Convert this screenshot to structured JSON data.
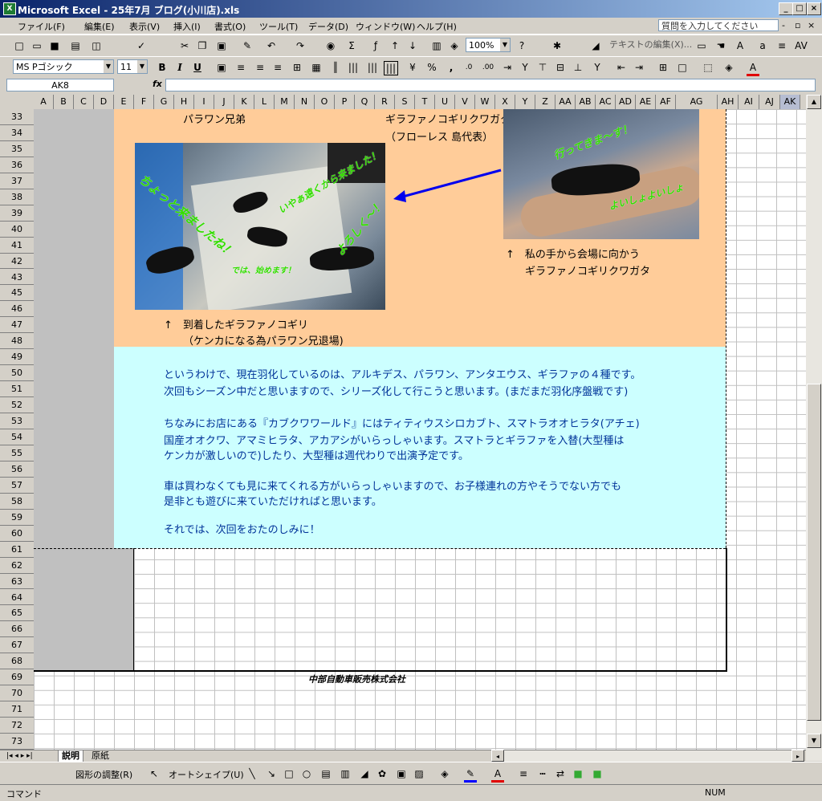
{
  "window": {
    "title": "Microsoft Excel - 25年7月 ブログ(小川店).xls",
    "app_icon": "X"
  },
  "menu": {
    "items": [
      "ファイル(F)",
      "編集(E)",
      "表示(V)",
      "挿入(I)",
      "書式(O)",
      "ツール(T)",
      "データ(D)",
      "ウィンドウ(W)",
      "ヘルプ(H)"
    ],
    "help_placeholder": "質問を入力してください"
  },
  "toolbar": {
    "zoom": "100%",
    "review_text": "テキストの編集(X)..."
  },
  "format": {
    "font": "MS Pゴシック",
    "size": "11",
    "bold": "B",
    "italic": "I",
    "underline": "U",
    "percent": "%",
    "comma": ","
  },
  "formula": {
    "namebox": "AK8",
    "fx": "fx"
  },
  "columns": [
    "A",
    "B",
    "C",
    "D",
    "E",
    "F",
    "G",
    "H",
    "I",
    "J",
    "K",
    "L",
    "M",
    "N",
    "O",
    "P",
    "Q",
    "R",
    "S",
    "T",
    "U",
    "V",
    "W",
    "X",
    "Y",
    "Z",
    "AA",
    "AB",
    "AC",
    "AD",
    "AE",
    "AF",
    "AG",
    "AH",
    "AI",
    "AJ",
    "AK"
  ],
  "rows": [
    "33",
    "34",
    "35",
    "36",
    "37",
    "38",
    "39",
    "40",
    "41",
    "42",
    "43",
    "45",
    "46",
    "47",
    "48",
    "49",
    "50",
    "51",
    "52",
    "53",
    "54",
    "55",
    "56",
    "57",
    "58",
    "59",
    "60",
    "61",
    "62",
    "63",
    "64",
    "65",
    "66",
    "67",
    "68",
    "69",
    "70",
    "71",
    "72",
    "73"
  ],
  "content": {
    "label_parawan": "パラワン兄弟",
    "label_giraffa_title": "ギラファノコギリクワガタ",
    "label_flores": "（フローレス 島代表）",
    "caption_left_1": "↑　到着したギラファノコギリ",
    "caption_left_2": "（ケンカになる為パラワン兄退場)",
    "caption_right_1": "↑　私の手から会場に向かう",
    "caption_right_2": "ギラファノコギリクワガタ",
    "photo_left_texts": [
      "ちょっと来ましたね！",
      "いやぁ遠くから来ました！",
      "よろしく〜！",
      "では、始めます！"
    ],
    "photo_right_texts": [
      "行ってきま〜す！",
      "よいしょよいしょ"
    ],
    "para1_line1": "というわけで、現在羽化しているのは、アルキデス、パラワン、アンタエウス、ギラファの４種です。",
    "para1_line2": "次回もシーズン中だと思いますので、シリーズ化して行こうと思います。(まだまだ羽化序盤戦です)",
    "para2_line1": "ちなみにお店にある『カブクワワールド』にはティティウスシロカブト、スマトラオオヒラタ(アチェ)",
    "para2_line2": "国産オオクワ、アマミヒラタ、アカアシがいらっしゃいます。スマトラとギラファを入替(大型種は",
    "para2_line3": "ケンカが激しいので)したり、大型種は週代わりで出演予定です。",
    "para3_line1": "車は買わなくても見に来てくれる方がいらっしゃいますので、お子様連れの方やそうでない方でも",
    "para3_line2": "是非とも遊びに来ていただければと思います。",
    "para4": "それでは、次回をおたのしみに！",
    "company": "中部自動車販売株式会社"
  },
  "sheets": {
    "tab1": "説明",
    "tab2": "原紙"
  },
  "drawing": {
    "adjust": "図形の調整(R)",
    "autoshape": "オートシェイプ(U)"
  },
  "status": {
    "mode": "コマンド",
    "num": "NUM"
  },
  "colors": {
    "orange": "#ffcc99",
    "cyan": "#ccffff",
    "text_blue": "#003399",
    "gray": "#c0c0c0"
  }
}
